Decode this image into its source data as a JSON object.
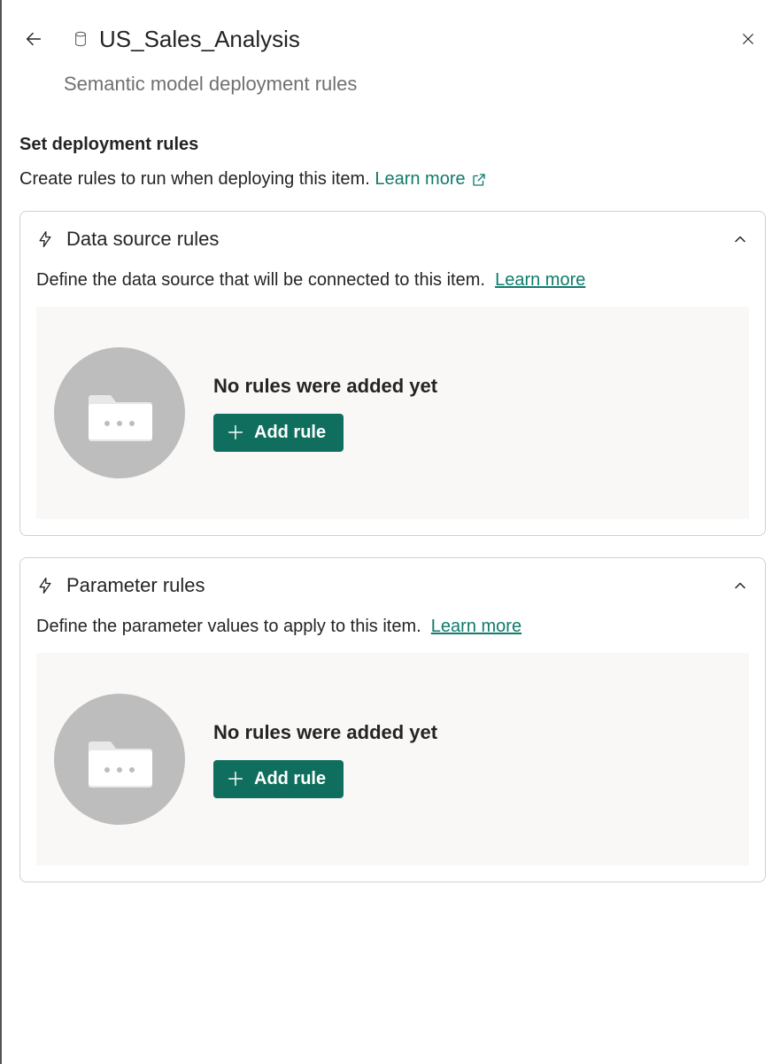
{
  "header": {
    "title": "US_Sales_Analysis",
    "subtitle": "Semantic model deployment rules"
  },
  "section": {
    "heading": "Set deployment rules",
    "description": "Create rules to run when deploying this item.",
    "learn_more": "Learn more"
  },
  "cards": {
    "datasource": {
      "title": "Data source rules",
      "description": "Define the data source that will be connected to this item.",
      "learn_more": "Learn more",
      "empty_text": "No rules were added yet",
      "add_label": "Add rule"
    },
    "parameter": {
      "title": "Parameter rules",
      "description": "Define the parameter values to apply to this item.",
      "learn_more": "Learn more",
      "empty_text": "No rules were added yet",
      "add_label": "Add rule"
    }
  }
}
